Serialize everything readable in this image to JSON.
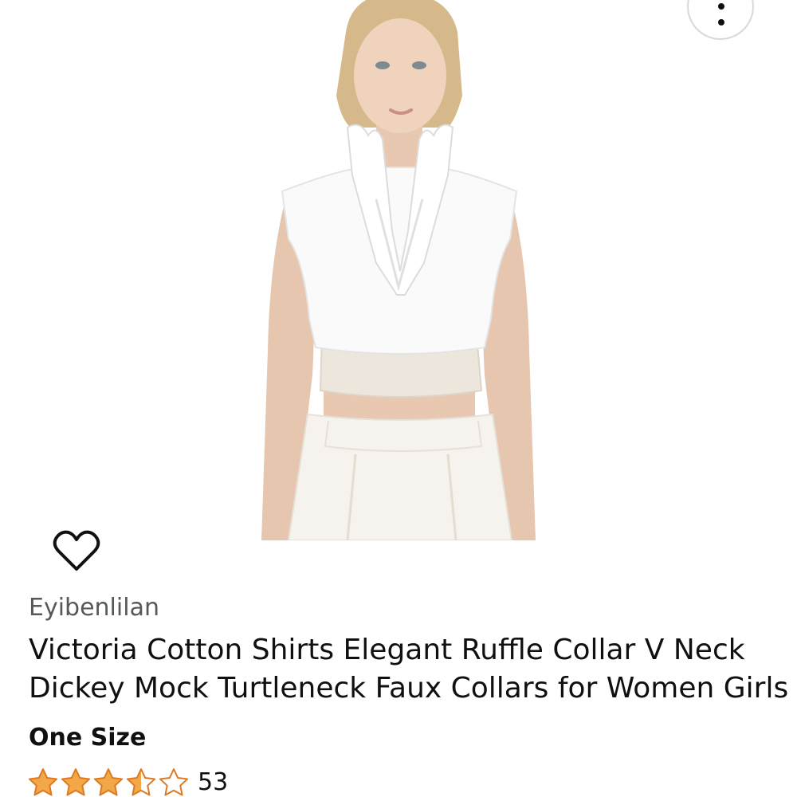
{
  "product": {
    "brand": "Eyibenlilan",
    "title_line_1": "Victoria Cotton Shirts Elegant Ruffle Collar V Neck",
    "title_line_2": "Dickey Mock Turtleneck Faux Collars for Women Girls",
    "size_label": "One Size",
    "rating_out_of_5": 3.5,
    "review_count": "53",
    "image_alt": "Woman wearing white ruffle collar dickey over cream top and white trousers"
  },
  "icons": {
    "more_options": "more-vertical-icon",
    "wishlist": "heart-outline-icon",
    "star": "star-icon"
  },
  "colors": {
    "star_fill": "#f3a847",
    "star_outline": "#de7921",
    "text_primary": "#0f1111",
    "text_secondary": "#565959",
    "button_border": "#d5d9d9"
  }
}
